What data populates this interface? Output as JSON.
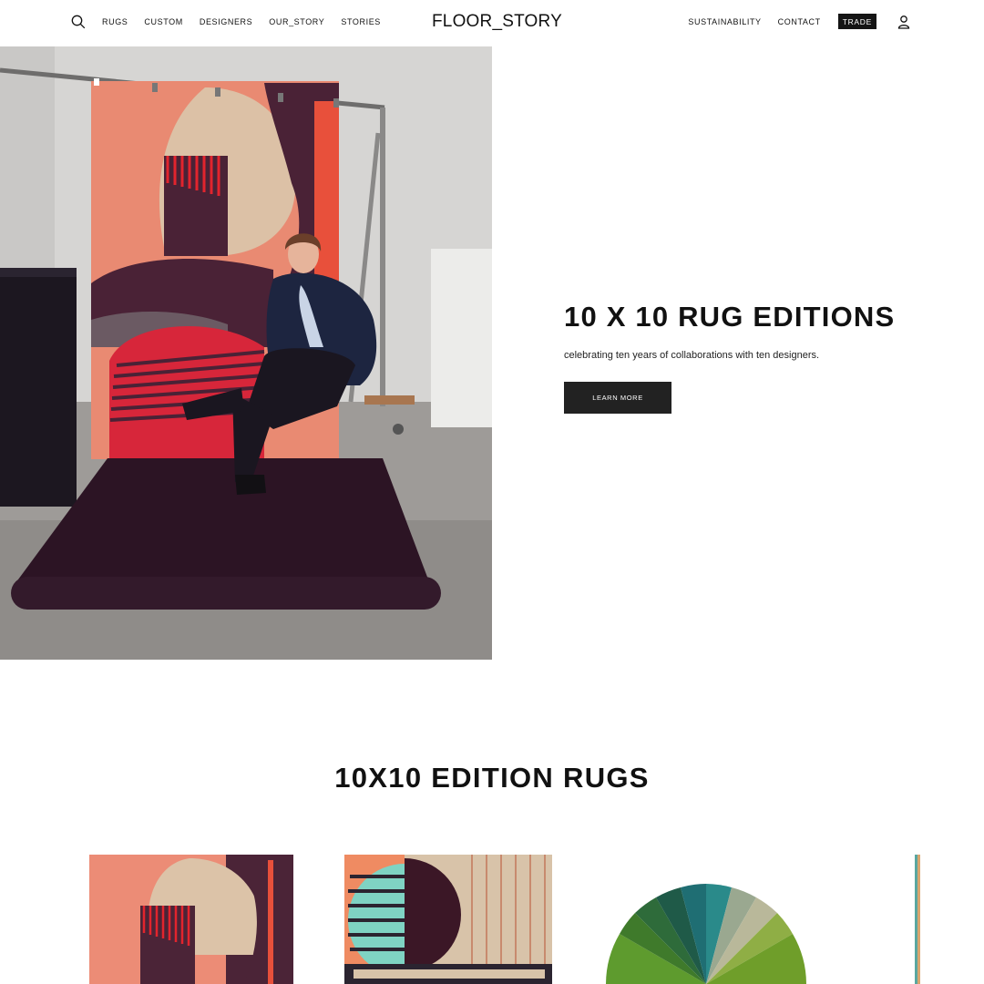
{
  "header": {
    "logo": "FLOOR_STORY",
    "nav_left": [
      "RUGS",
      "CUSTOM",
      "DESIGNERS",
      "OUR_STORY",
      "STORIES"
    ],
    "nav_right": [
      "SUSTAINABILITY",
      "CONTACT"
    ],
    "trade": "TRADE"
  },
  "hero": {
    "title": "10 X 10 RUG EDITIONS",
    "subtitle": "celebrating ten years of collaborations with ten designers.",
    "button": "LEARN MORE"
  },
  "section": {
    "title": "10X10 EDITION RUGS"
  },
  "icons": {
    "search": "search-icon",
    "account": "user-icon"
  },
  "colors": {
    "button_bg": "#222222",
    "trade_bg": "#151515",
    "rug_salmon": "#e98a72",
    "rug_plum": "#4a2236",
    "rug_red": "#e2242d",
    "rug_beige": "#dcc1a6"
  }
}
